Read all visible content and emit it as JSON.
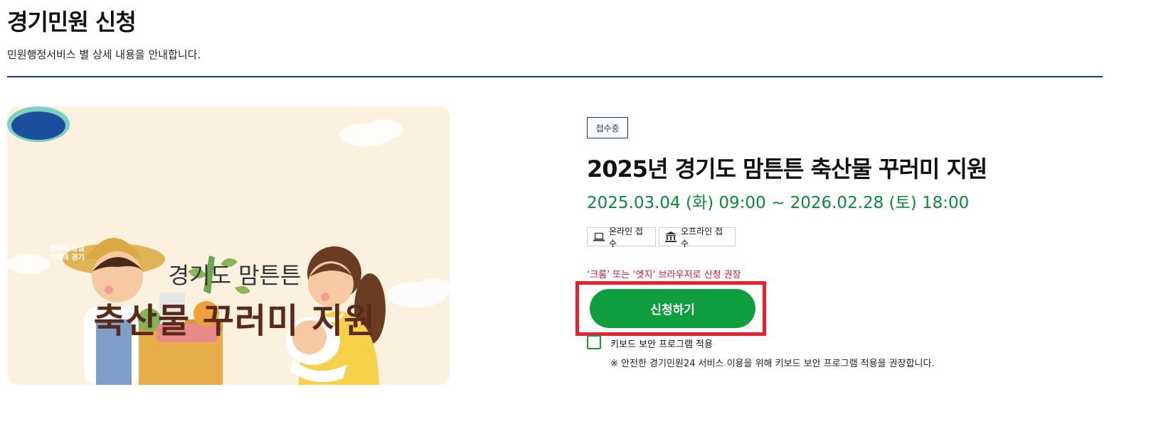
{
  "page": {
    "title": "경기민원 신청",
    "subtitle": "민원행정서비스 별 상세 내용을 안내합니다."
  },
  "banner": {
    "logo_line1": "변화의 중심",
    "logo_line2": "기회의 경기",
    "line1": "경기도 맘튼튼",
    "line2": "축산물 꾸러미 지원"
  },
  "service": {
    "status": "접수중",
    "title": "2025년 경기도 맘튼튼 축산물 꾸러미 지원",
    "period": "2025.03.04 (화) 09:00 ~ 2026.02.28 (토) 18:00",
    "methods": {
      "online": "온라인 접수",
      "offline": "오프라인 접수"
    },
    "browser_note": "‘크롬’ 또는 ‘엣지‘ 브라우저로 신청 권장",
    "apply_label": "신청하기",
    "keyboard_label": "키보드 보안 프로그램 적용",
    "keyboard_note": "※ 안전한 경기민원24 서비스 이용을 위해 키보드 보안 프로그램 적용을 권장합니다."
  },
  "colors": {
    "accent_green": "#0f9d3e",
    "header_blue": "#1f3b8a",
    "warning_red": "#d4143c",
    "highlight_red": "#e8202d"
  },
  "icons": {
    "online": "laptop-icon",
    "offline": "institution-icon"
  }
}
